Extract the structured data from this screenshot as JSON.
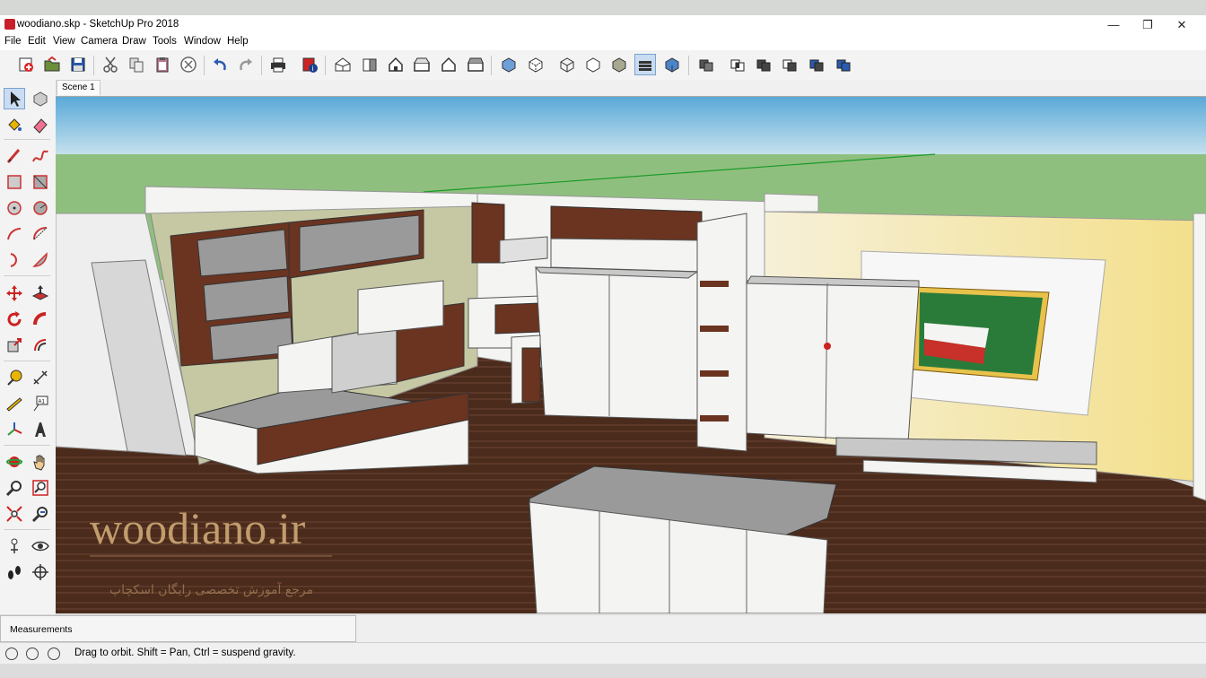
{
  "window": {
    "title": "woodiano.skp - SketchUp Pro 2018",
    "minimize_glyph": "—",
    "restore_glyph": "❐",
    "close_glyph": "✕"
  },
  "menu": [
    "File",
    "Edit",
    "View",
    "Camera",
    "Draw",
    "Tools",
    "Window",
    "Help"
  ],
  "toolbar": {
    "icons": [
      "new-icon",
      "open-icon",
      "save-icon",
      "cut-icon",
      "copy-icon",
      "paste-icon",
      "erase-icon",
      "undo-icon",
      "redo-icon",
      "print-icon",
      "model-info-icon",
      "iso-view-icon",
      "top-view-icon",
      "front-view-icon",
      "right-view-icon",
      "back-view-icon",
      "left-view-icon",
      "xray-icon",
      "back-edges-icon",
      "wireframe-icon",
      "hidden-line-icon",
      "shaded-icon",
      "shaded-textures-icon",
      "monochrome-icon",
      "outer-shell-icon",
      "intersect-icon",
      "union-icon",
      "subtract-icon",
      "trim-icon",
      "split-icon"
    ],
    "active_icon": "shaded-textures-icon"
  },
  "scenes": {
    "tabs": [
      "Scene 1"
    ]
  },
  "left_tools": {
    "icons": [
      "select-icon",
      "make-component-icon",
      "paint-bucket-icon",
      "eraser-icon",
      "line-icon",
      "freehand-icon",
      "rectangle-icon",
      "rotated-rectangle-icon",
      "circle-icon",
      "polygon-icon",
      "arc-icon",
      "two-point-arc-icon",
      "three-point-arc-icon",
      "pie-icon",
      "move-icon",
      "push-pull-icon",
      "rotate-icon",
      "follow-me-icon",
      "scale-icon",
      "offset-icon",
      "tape-measure-icon",
      "dimensions-icon",
      "protractor-icon",
      "text-icon",
      "axes-icon",
      "3d-text-icon",
      "orbit-icon",
      "pan-icon",
      "zoom-icon",
      "zoom-window-icon",
      "zoom-extents-icon",
      "previous-view-icon",
      "position-camera-icon",
      "look-around-icon",
      "walk-icon",
      "section-plane-icon"
    ],
    "active_icon": "select-icon"
  },
  "viewport": {
    "watermark": "woodiano.ir",
    "watermark_subtitle": "مرجع آموزش تخصصی رایگان اسکچاپ",
    "colors": {
      "sky": "#5aa9d8",
      "ground": "#8fbf7e",
      "floor": "#4b2b1c",
      "wood": "#6a3420",
      "panel": "#9a9a9a",
      "wall": "#f4f4f2"
    }
  },
  "measurements": {
    "label": "Measurements",
    "value": ""
  },
  "status": {
    "text": "Drag to orbit. Shift = Pan, Ctrl = suspend gravity.",
    "icons": [
      "geo-location-icon",
      "credits-icon",
      "user-icon"
    ]
  }
}
